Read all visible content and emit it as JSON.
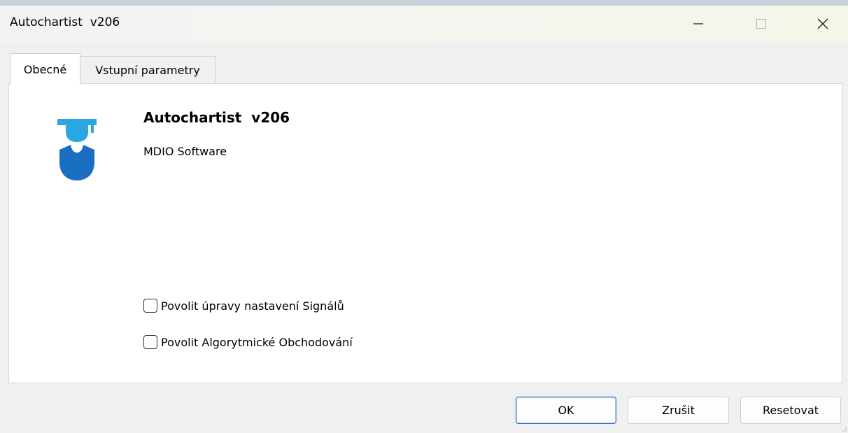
{
  "window": {
    "title": "Autochartist  v206",
    "controls": {
      "minimize": "minimize-icon",
      "maximize": "maximize-icon",
      "close": "close-icon"
    }
  },
  "tabs": [
    {
      "label": "Obecné",
      "active": true
    },
    {
      "label": "Vstupní parametry",
      "active": false
    }
  ],
  "general": {
    "app_name": "Autochartist  v206",
    "vendor": "MDIO Software",
    "logo_icon": "graduate-icon",
    "logo_colors": {
      "cap": "#2aa6e0",
      "body": "#1b6fc0"
    },
    "checkboxes": [
      {
        "label": "Povolit úpravy nastavení Signálů",
        "checked": false
      },
      {
        "label": "Povolit Algorytmické Obchodování",
        "checked": false
      }
    ]
  },
  "buttons": {
    "ok": "OK",
    "cancel": "Zrušit",
    "reset": "Resetovat"
  },
  "colors": {
    "accent": "#2f6fc4"
  }
}
